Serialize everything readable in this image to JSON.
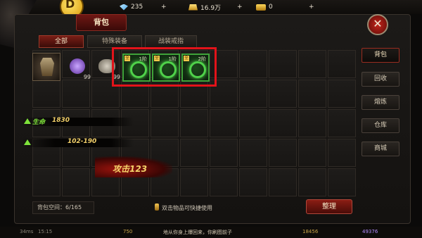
{
  "topbar": {
    "coin_symbol": "D",
    "diamonds": "235",
    "gold": "16.9万",
    "bars": "0",
    "plus": "+"
  },
  "panel": {
    "title": "背包",
    "close": "✕",
    "tabs": [
      {
        "label": "全部",
        "active": true
      },
      {
        "label": "特殊装备",
        "active": false
      },
      {
        "label": "战装戒指",
        "active": false
      }
    ]
  },
  "items": [
    {
      "kind": "armor",
      "count": ""
    },
    {
      "kind": "purple-gem",
      "count": "99"
    },
    {
      "kind": "stone",
      "count": "99"
    },
    {
      "kind": "green-ring",
      "level": "1阶",
      "tag": "全"
    },
    {
      "kind": "green-ring",
      "level": "1阶",
      "tag": "全"
    },
    {
      "kind": "green-ring",
      "level": "2阶",
      "tag": "全"
    }
  ],
  "stats": {
    "hp_label": "生命",
    "hp_value": "1830",
    "range": "102-190",
    "attack": "攻击123"
  },
  "bottom": {
    "capacity": "背包空间：6/165",
    "hint": "双击物品可快捷使用",
    "sort": "整理"
  },
  "side_menu": [
    {
      "label": "背包",
      "active": true
    },
    {
      "label": "回收",
      "active": false
    },
    {
      "label": "熔炼",
      "active": false
    },
    {
      "label": "仓库",
      "active": false
    },
    {
      "label": "商城",
      "active": false
    }
  ],
  "footer": {
    "fps": "34ms",
    "time": "15:15",
    "chat": "地从你身上爆回来，你刷图前子",
    "n1": "750",
    "n2": "18456",
    "n3": "49376"
  }
}
